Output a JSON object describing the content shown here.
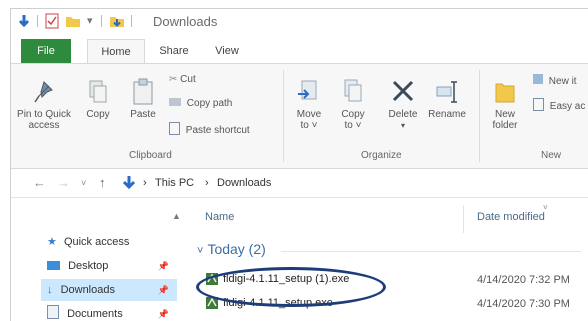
{
  "window": {
    "title": "Downloads"
  },
  "ribbon_tabs": {
    "file": "File",
    "home": "Home",
    "share": "Share",
    "view": "View"
  },
  "clipboard": {
    "pin_label": "Pin to Quick\naccess",
    "copy_label": "Copy",
    "paste_label": "Paste",
    "cut_label": "Cut",
    "copy_path_label": "Copy path",
    "paste_shortcut_label": "Paste shortcut",
    "group_label": "Clipboard"
  },
  "organize": {
    "move_label": "Move\nto ˅",
    "copy_label": "Copy\nto ˅",
    "delete_label": "Delete",
    "rename_label": "Rename",
    "group_label": "Organize"
  },
  "new": {
    "new_folder_label": "New\nfolder",
    "new_item_label": "New it",
    "easy_access_label": "Easy ac",
    "group_label": "New"
  },
  "address": {
    "crumbs": [
      "This PC",
      "Downloads"
    ]
  },
  "nav": {
    "items": [
      {
        "label": "Quick access"
      },
      {
        "label": "Desktop"
      },
      {
        "label": "Downloads"
      },
      {
        "label": "Documents"
      }
    ]
  },
  "columns": {
    "name": "Name",
    "date": "Date modified"
  },
  "groups": {
    "today": "Today (2)"
  },
  "files": [
    {
      "name": "fldigi-4.1.11_setup (1).exe",
      "date": "4/14/2020 7:32 PM"
    },
    {
      "name": "fldigi-4.1.11_setup.exe",
      "date": "4/14/2020 7:30 PM"
    }
  ],
  "colors": {
    "accent": "#2e8b3e",
    "highlight": "#cce8ff",
    "annotation": "#1f3c7a"
  }
}
